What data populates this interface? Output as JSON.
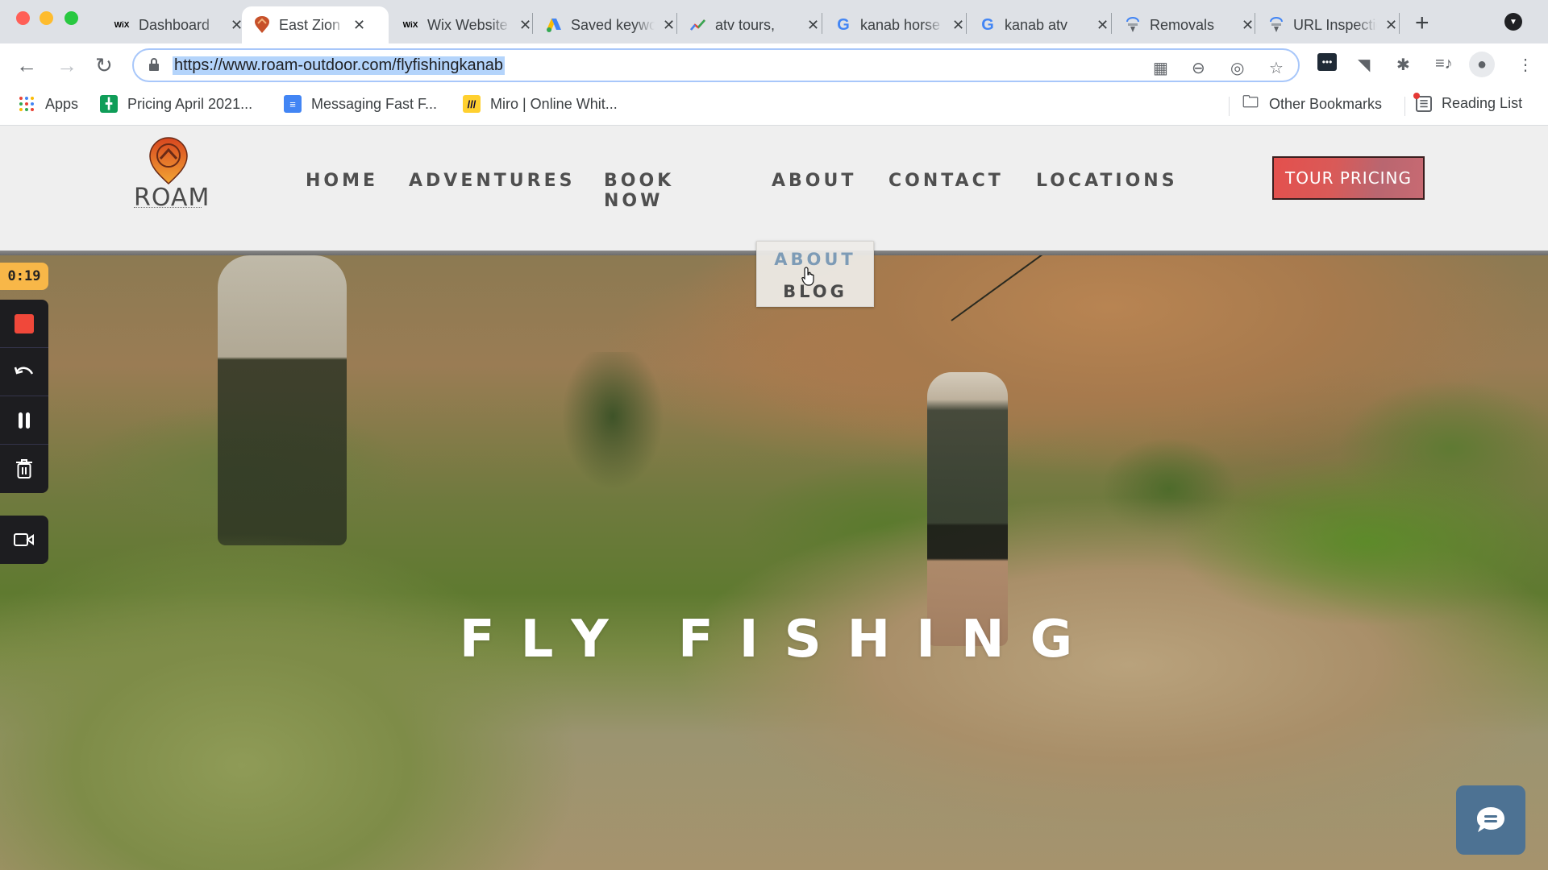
{
  "browser": {
    "tabs": [
      {
        "title": "Dashboard",
        "favicon": "wix-icon",
        "active": false
      },
      {
        "title": "East Zion",
        "favicon": "roam-logo-icon",
        "active": true
      },
      {
        "title": "Wix Website",
        "favicon": "wix-icon",
        "active": false
      },
      {
        "title": "Saved keywords",
        "favicon": "google-ads-icon",
        "active": false
      },
      {
        "title": "atv tours,",
        "favicon": "trends-icon",
        "active": false
      },
      {
        "title": "kanab horse",
        "favicon": "google-icon",
        "active": false
      },
      {
        "title": "kanab atv",
        "favicon": "google-icon",
        "active": false
      },
      {
        "title": "Removals",
        "favicon": "search-console-icon",
        "active": false
      },
      {
        "title": "URL Inspection",
        "favicon": "search-console-icon",
        "active": false
      }
    ],
    "favicon_text": {
      "wix": "WiX",
      "google": "G"
    },
    "close_glyph": "✕",
    "new_tab_glyph": "+",
    "url": "https://www.roam-outdoor.com/flyfishingkanab",
    "bookmarks": [
      {
        "label": "Apps",
        "icon": "apps-grid-icon"
      },
      {
        "label": "Pricing April 2021...",
        "icon": "google-sheets-icon"
      },
      {
        "label": "Messaging Fast F...",
        "icon": "google-docs-icon"
      },
      {
        "label": "Miro | Online Whit...",
        "icon": "miro-icon"
      }
    ],
    "bookmarks_right": [
      {
        "label": "Other Bookmarks",
        "icon": "folder-icon"
      },
      {
        "label": "Reading List",
        "icon": "reading-list-icon"
      }
    ]
  },
  "site": {
    "logo_text": "ROAM",
    "nav": [
      "HOME",
      "ADVENTURES",
      "BOOK NOW",
      "ABOUT",
      "CONTACT",
      "LOCATIONS"
    ],
    "cta_label": "TOUR PRICING",
    "dropdown": [
      {
        "label": "ABOUT",
        "hovered": true
      },
      {
        "label": "BLOG",
        "hovered": false
      }
    ],
    "hero_title": "FLY FISHING",
    "colors": {
      "accent": "#e4504d",
      "nav_text": "#4f4f4f",
      "dropdown_hover": "#7d9bb6",
      "chat_bg": "#4d7293",
      "header_bg": "#efefef"
    }
  },
  "recorder": {
    "timer": "0:19",
    "buttons": [
      "stop",
      "undo",
      "pause",
      "delete"
    ],
    "camera": "camera"
  }
}
